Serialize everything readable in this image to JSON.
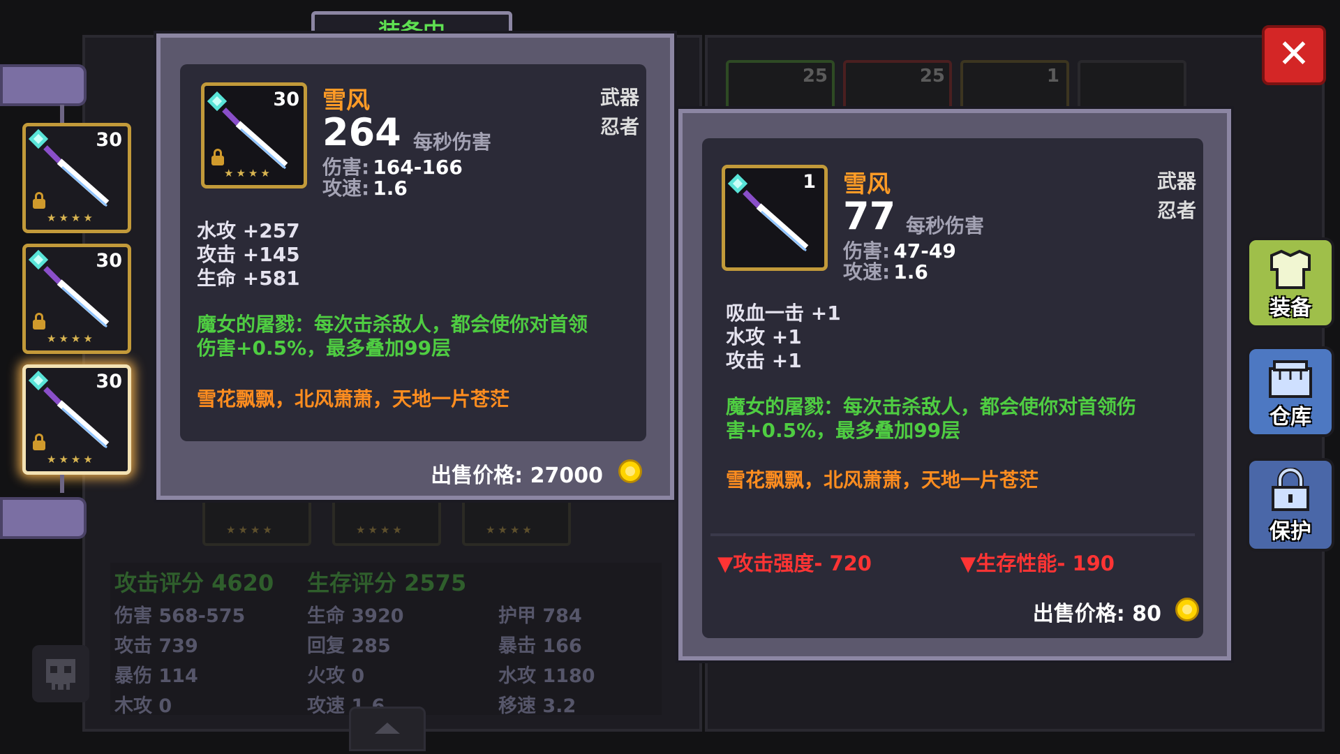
{
  "header": {
    "equipped_tab": "装备中"
  },
  "close_button": {
    "symbol": "✕"
  },
  "inventory": {
    "slots": [
      {
        "level": "30",
        "stars": "★★★★"
      },
      {
        "level": "30",
        "stars": "★★★★"
      },
      {
        "level": "30",
        "stars": "★★★★"
      }
    ]
  },
  "background_slots": [
    {
      "level": "25"
    },
    {
      "level": "25"
    },
    {
      "level": "1"
    }
  ],
  "stats_panel": {
    "attack_score": "攻击评分 4620",
    "survival_score": "生存评分 2575",
    "rows": [
      [
        "伤害 568-575",
        "生命 3920",
        "护甲 784"
      ],
      [
        "攻击 739",
        "回复 285",
        "暴击 166"
      ],
      [
        "暴伤 114",
        "火攻 0",
        "水攻 1180"
      ],
      [
        "木攻 0",
        "攻速 1.6",
        "移速 3.2"
      ]
    ]
  },
  "equipped_item": {
    "level": "30",
    "name": "雪风",
    "category": "武器",
    "class": "忍者",
    "dps": "264",
    "dps_label": "每秒伤害",
    "damage_label": "伤害:",
    "damage": "164-166",
    "speed_label": "攻速:",
    "speed": "1.6",
    "stars": "★★★★",
    "attributes": [
      "水攻 +257",
      "攻击 +145",
      "生命 +581"
    ],
    "special_line1": "魔女的屠戮：每次击杀敌人，都会使你对首领",
    "special_line2": "伤害+0.5%，最多叠加99层",
    "flavor": "雪花飘飘，北风萧萧，天地一片苍茫",
    "price": "出售价格: 27000"
  },
  "compare_item": {
    "level": "1",
    "name": "雪风",
    "category": "武器",
    "class": "忍者",
    "dps": "77",
    "dps_label": "每秒伤害",
    "damage_label": "伤害:",
    "damage": "47-49",
    "speed_label": "攻速:",
    "speed": "1.6",
    "attributes": [
      "吸血一击 +1",
      "水攻 +1",
      "攻击 +1"
    ],
    "special_line1": "魔女的屠戮：每次击杀敌人，都会使你对首领伤",
    "special_line2": "害+0.5%，最多叠加99层",
    "flavor": "雪花飘飘，北风萧萧，天地一片苍茫",
    "diff_attack": "攻击强度- 720",
    "diff_survival": "生存性能- 190",
    "price": "出售价格: 80"
  },
  "side_buttons": {
    "equip": "装备",
    "storage": "仓库",
    "protect": "保护"
  },
  "colors": {
    "rarity_border": "#c29a3a",
    "item_name": "#ff9b26",
    "special_text": "#4fcd42",
    "decrease": "#ff3434",
    "equip_button": "#9fbf4a",
    "storage_button": "#4d78c2",
    "protect_button": "#4a67a8",
    "close_button": "#d42626"
  }
}
